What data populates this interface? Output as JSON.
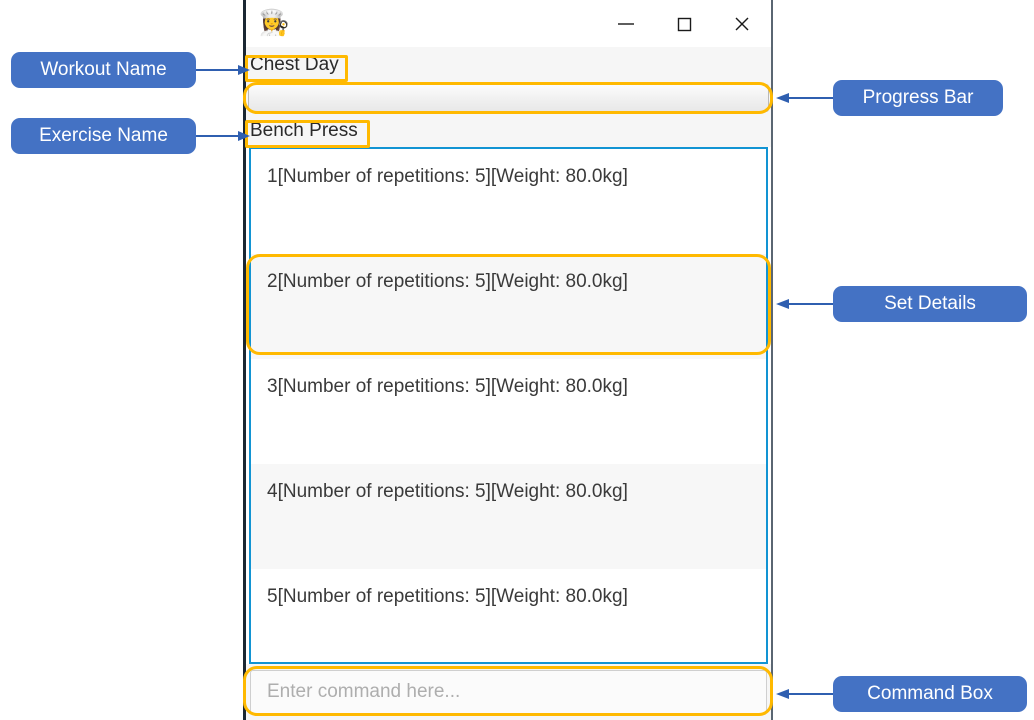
{
  "window": {
    "icon": "chef-emoji",
    "icon_glyph": "👩‍🍳",
    "controls": {
      "minimize": "minimize-icon",
      "maximize": "maximize-icon",
      "close": "close-icon"
    }
  },
  "workout": {
    "name": "Chest Day"
  },
  "progress": {
    "percent": 0,
    "value_label": ""
  },
  "exercise": {
    "name": "Bench Press"
  },
  "sets": [
    {
      "text": "1[Number of repetitions: 5][Weight: 80.0kg]"
    },
    {
      "text": "2[Number of repetitions: 5][Weight: 80.0kg]"
    },
    {
      "text": "3[Number of repetitions: 5][Weight: 80.0kg]"
    },
    {
      "text": "4[Number of repetitions: 5][Weight: 80.0kg]"
    },
    {
      "text": "5[Number of repetitions: 5][Weight: 80.0kg]"
    }
  ],
  "command": {
    "value": "",
    "placeholder": "Enter command here..."
  },
  "annotations": {
    "workout_name": "Workout Name",
    "exercise_name": "Exercise Name",
    "progress_bar": "Progress Bar",
    "set_details": "Set Details",
    "command_box": "Command Box"
  },
  "colors": {
    "highlight": "#ffb900",
    "callout": "#4472c4",
    "list_border": "#1294d3",
    "arrow": "#2f5fb0"
  }
}
